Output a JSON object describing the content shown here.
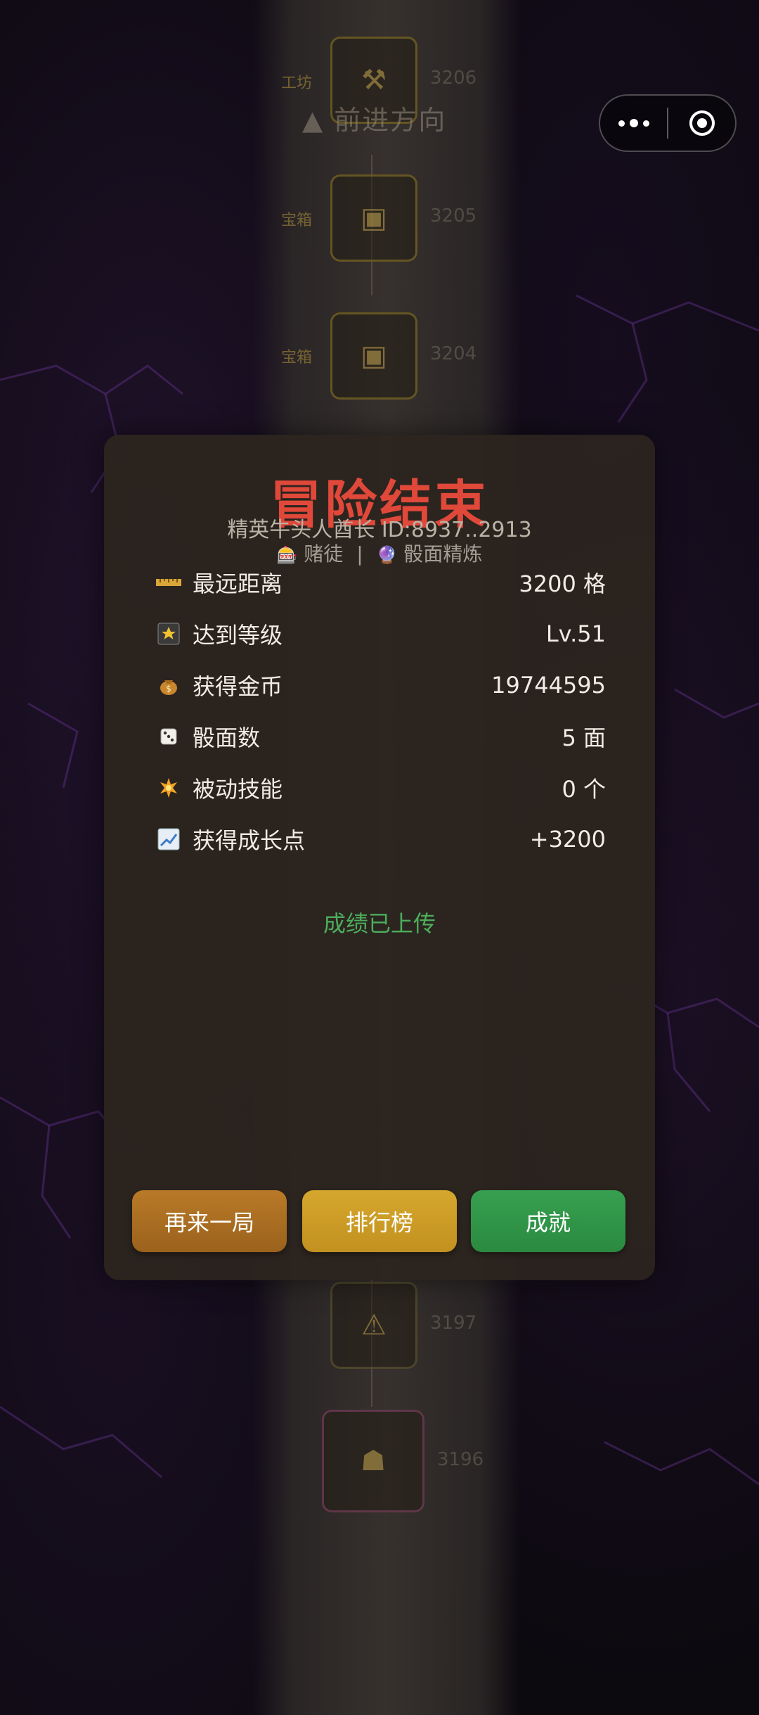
{
  "background": {
    "forward_label": "▲ 前进方向",
    "tiles": [
      {
        "label": "工坊",
        "number": "3206"
      },
      {
        "label": "宝箱",
        "number": "3205"
      },
      {
        "label": "宝箱",
        "number": "3204"
      },
      {
        "label": "",
        "number": "3197"
      },
      {
        "label": "",
        "number": "3196"
      }
    ]
  },
  "capsule": {
    "more_icon": "more-dots-icon",
    "close_icon": "target-circle-icon"
  },
  "dialog": {
    "title": "冒险结束",
    "subtitle": "精英牛头人酋长  ID:8937..2913",
    "tag1": "赌徒",
    "tag_separator": "|",
    "tag2": "骰面精炼",
    "stats": [
      {
        "icon": "ruler-icon",
        "label": "最远距离",
        "value": "3200 格"
      },
      {
        "icon": "star-icon",
        "label": "达到等级",
        "value": "Lv.51"
      },
      {
        "icon": "money-bag-icon",
        "label": "获得金币",
        "value": "19744595"
      },
      {
        "icon": "dice-icon",
        "label": "骰面数",
        "value": "5 面"
      },
      {
        "icon": "sparkle-icon",
        "label": "被动技能",
        "value": "0 个"
      },
      {
        "icon": "chart-icon",
        "label": "获得成长点",
        "value": "+3200"
      }
    ],
    "upload_status": "成绩已上传",
    "buttons": {
      "again": "再来一局",
      "leaderboard": "排行榜",
      "achievements": "成就"
    }
  },
  "colors": {
    "title": "#e0483a",
    "uploaded": "#4cae5c",
    "again": "#b0721f",
    "leaderboard": "#d0a02a",
    "achievements": "#2f9748"
  }
}
